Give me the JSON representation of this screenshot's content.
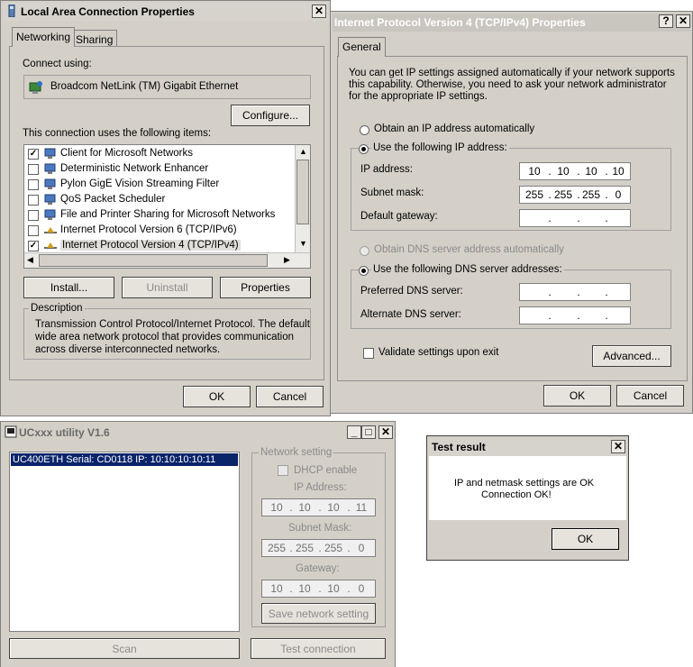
{
  "lac": {
    "title": "Local Area Connection Properties",
    "tabs": [
      "Networking",
      "Sharing"
    ],
    "connect_using_label": "Connect using:",
    "adapter": "Broadcom NetLink (TM) Gigabit Ethernet",
    "configure_button": "Configure...",
    "items_label": "This connection uses the following items:",
    "items": [
      {
        "label": "Client for Microsoft Networks",
        "checked": true,
        "icon": "network-client-icon"
      },
      {
        "label": "Deterministic Network Enhancer",
        "checked": false,
        "icon": "network-service-icon"
      },
      {
        "label": "Pylon GigE Vision Streaming Filter",
        "checked": false,
        "icon": "network-service-icon"
      },
      {
        "label": "QoS Packet Scheduler",
        "checked": false,
        "icon": "network-service-icon"
      },
      {
        "label": "File and Printer Sharing for Microsoft Networks",
        "checked": false,
        "icon": "network-service-icon"
      },
      {
        "label": "Internet Protocol Version 6 (TCP/IPv6)",
        "checked": false,
        "icon": "protocol-icon"
      },
      {
        "label": "Internet Protocol Version 4 (TCP/IPv4)",
        "checked": true,
        "icon": "protocol-icon"
      }
    ],
    "install_button": "Install...",
    "uninstall_button": "Uninstall",
    "properties_button": "Properties",
    "description_label": "Description",
    "description_lines": [
      "Transmission Control Protocol/Internet Protocol. The default",
      "wide area network protocol that provides communication",
      "across diverse interconnected networks."
    ],
    "ok_button": "OK",
    "cancel_button": "Cancel"
  },
  "ipv4": {
    "title": "Internet Protocol Version 4 (TCP/IPv4) Properties",
    "help_button": "?",
    "tab": "General",
    "info_lines": [
      "You can get IP settings assigned automatically if your network supports",
      "this capability. Otherwise, you need to ask your network administrator",
      "for the appropriate IP settings."
    ],
    "auto_ip_label": "Obtain an IP address automatically",
    "manual_ip_label": "Use the following IP address:",
    "ip_address_label": "IP address:",
    "ip_address": [
      "10",
      "10",
      "10",
      "10"
    ],
    "subnet_label": "Subnet mask:",
    "subnet": [
      "255",
      "255",
      "255",
      "0"
    ],
    "gateway_label": "Default gateway:",
    "gateway": [
      "",
      "",
      "",
      ""
    ],
    "auto_dns_label": "Obtain DNS server address automatically",
    "manual_dns_label": "Use the following DNS server addresses:",
    "preferred_dns_label": "Preferred DNS server:",
    "alternate_dns_label": "Alternate DNS server:",
    "validate_label": "Validate settings upon exit",
    "advanced_button": "Advanced...",
    "ok_button": "OK",
    "cancel_button": "Cancel"
  },
  "uc": {
    "title": "UCxxx utility  V1.6",
    "device_entry": "UC400ETH Serial: CD0118    IP: 10:10:10:10:11",
    "network_setting_label": "Network setting",
    "dhcp_label": "DHCP enable",
    "ip_label": "IP Address:",
    "ip": [
      "10",
      "10",
      "10",
      "11"
    ],
    "subnet_label": "Subnet Mask:",
    "subnet": [
      "255",
      "255",
      "255",
      "0"
    ],
    "gateway_label": "Gateway:",
    "gateway": [
      "10",
      "10",
      "10",
      "0"
    ],
    "save_button": "Save network setting",
    "scan_button": "Scan",
    "test_button": "Test connection"
  },
  "result": {
    "title": "Test result",
    "line1": "IP and netmask settings are OK",
    "line2": "Connection OK!",
    "ok_button": "OK"
  },
  "colors": {
    "dialog_face": "#d4d0c8",
    "selection": "#0a246a"
  }
}
